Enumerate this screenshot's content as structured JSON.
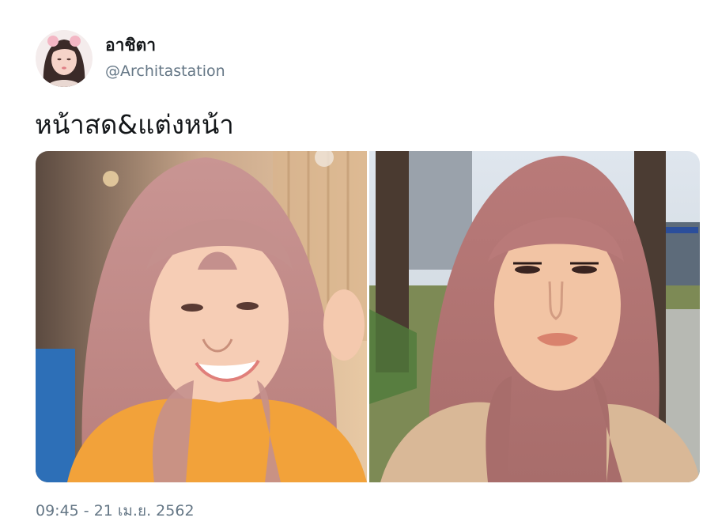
{
  "tweet": {
    "author": {
      "display_name": "อาชิตา",
      "handle": "@Architastation"
    },
    "text": "หน้าสด&แต่งหน้า",
    "media": [
      {
        "kind": "photo",
        "subject": "selfie-no-makeup"
      },
      {
        "kind": "photo",
        "subject": "selfie-with-makeup"
      }
    ],
    "timestamp": "09:45 - 21 เม.ย. 2562"
  },
  "colors": {
    "text_primary": "#14171a",
    "text_secondary": "#657786",
    "hair_pink": "#c9908f",
    "jacket_orange": "#f2a23a",
    "coat_beige": "#d9b897"
  }
}
